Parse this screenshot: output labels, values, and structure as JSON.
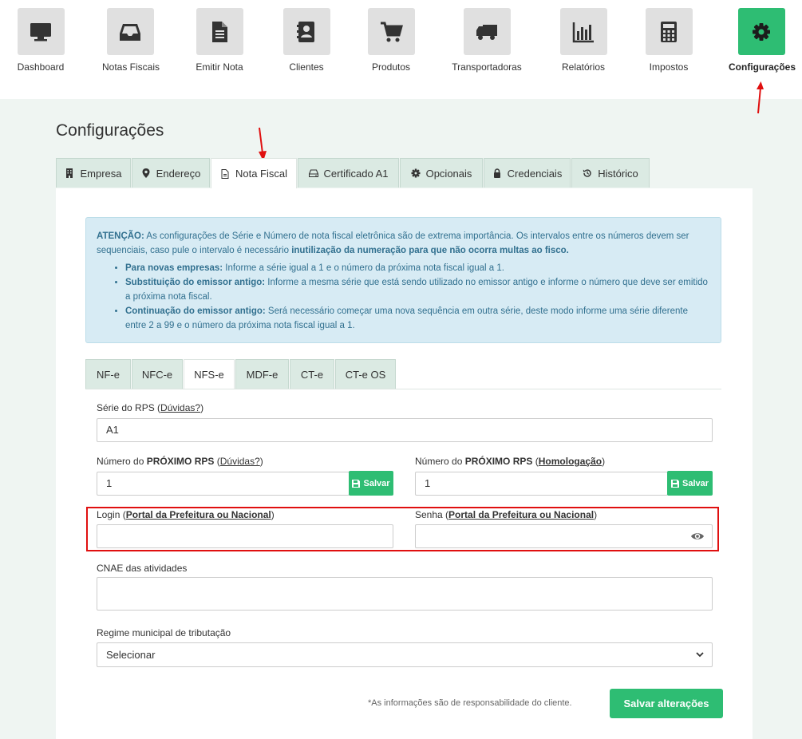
{
  "nav": {
    "items": [
      {
        "label": "Dashboard",
        "icon": "monitor-icon"
      },
      {
        "label": "Notas Fiscais",
        "icon": "inbox-icon"
      },
      {
        "label": "Emitir Nota",
        "icon": "document-icon"
      },
      {
        "label": "Clientes",
        "icon": "contacts-icon"
      },
      {
        "label": "Produtos",
        "icon": "cart-icon"
      },
      {
        "label": "Transportadoras",
        "icon": "truck-icon"
      },
      {
        "label": "Relatórios",
        "icon": "bar-chart-icon"
      },
      {
        "label": "Impostos",
        "icon": "calculator-icon"
      },
      {
        "label": "Configurações",
        "icon": "gear-icon"
      }
    ],
    "active": "Configurações",
    "active_color": "#2ebd73"
  },
  "page": {
    "title": "Configurações"
  },
  "tabs": [
    {
      "label": "Empresa",
      "icon": "building-icon"
    },
    {
      "label": "Endereço",
      "icon": "map-marker-icon"
    },
    {
      "label": "Nota Fiscal",
      "icon": "file-icon"
    },
    {
      "label": "Certificado A1",
      "icon": "drive-icon"
    },
    {
      "label": "Opcionais",
      "icon": "cog-icon"
    },
    {
      "label": "Credenciais",
      "icon": "lock-icon"
    },
    {
      "label": "Histórico",
      "icon": "history-icon"
    }
  ],
  "active_tab": "Nota Fiscal",
  "alert": {
    "lead_bold": "ATENÇÃO:",
    "lead_text": " As configurações de Série e Número de nota fiscal eletrônica são de extrema importância. Os intervalos entre os números devem ser sequenciais, caso pule o intervalo é necessário ",
    "lead_emph": "inutilização da numeração para que não ocorra multas ao fisco.",
    "items": [
      {
        "bold": "Para novas empresas:",
        "text": " Informe a série igual a 1 e o número da próxima nota fiscal igual a 1."
      },
      {
        "bold": "Substituição do emissor antigo:",
        "text": " Informe a mesma série que está sendo utilizado no emissor antigo e informe o número que deve ser emitido a próxima nota fiscal."
      },
      {
        "bold": "Continuação do emissor antigo:",
        "text": " Será necessário começar uma nova sequência em outra série, deste modo informe uma série diferente entre 2 a 99 e o número da próxima nota fiscal igual a 1."
      }
    ]
  },
  "subtabs": [
    "NF-e",
    "NFC-e",
    "NFS-e",
    "MDF-e",
    "CT-e",
    "CT-e OS"
  ],
  "active_subtab": "NFS-e",
  "form": {
    "serie_label": "Série do RPS (",
    "serie_link": "Dúvidas?",
    "serie_label_end": ")",
    "serie_value": "A1",
    "numero_label": "Número do ",
    "numero_bold": "PRÓXIMO RPS",
    "numero_open": " (",
    "numero_link": "Dúvidas?",
    "numero_close": ")",
    "numero_value": "1",
    "numero_hom_label": "Número do ",
    "numero_hom_bold": "PRÓXIMO RPS",
    "numero_hom_open": " (",
    "numero_hom_link": "Homologação",
    "numero_hom_close": ")",
    "numero_hom_value": "1",
    "save_small": "Salvar",
    "login_label": "Login (",
    "login_link": "Portal da Prefeitura ou Nacional",
    "login_close": ")",
    "login_value": "",
    "senha_label": "Senha (",
    "senha_link": "Portal da Prefeitura ou Nacional",
    "senha_close": ")",
    "senha_value": "",
    "cnae_label": "CNAE das atividades",
    "cnae_value": "",
    "regime_label": "Regime municipal de tributação",
    "regime_value": "Selecionar"
  },
  "footer": {
    "note": "*As informações são de responsabilidade do cliente.",
    "save_button": "Salvar alterações"
  },
  "colors": {
    "accent": "#2ebd73",
    "annotation_red": "#e01010",
    "alert_bg": "#d7ebf4",
    "alert_text": "#31708f"
  }
}
